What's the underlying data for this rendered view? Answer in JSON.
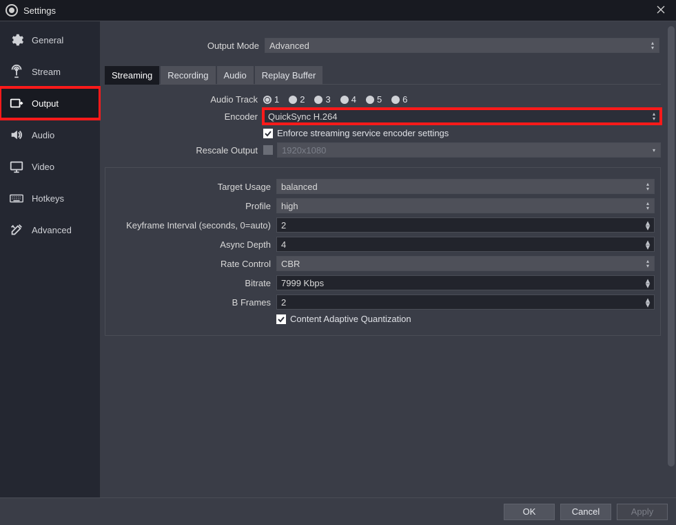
{
  "window": {
    "title": "Settings"
  },
  "sidebar": {
    "items": [
      {
        "label": "General"
      },
      {
        "label": "Stream"
      },
      {
        "label": "Output"
      },
      {
        "label": "Audio"
      },
      {
        "label": "Video"
      },
      {
        "label": "Hotkeys"
      },
      {
        "label": "Advanced"
      }
    ],
    "active_index": 2
  },
  "output_mode": {
    "label": "Output Mode",
    "value": "Advanced"
  },
  "tabs": [
    {
      "label": "Streaming"
    },
    {
      "label": "Recording"
    },
    {
      "label": "Audio"
    },
    {
      "label": "Replay Buffer"
    }
  ],
  "active_tab": 0,
  "streaming": {
    "audio_track_label": "Audio Track",
    "audio_tracks": [
      "1",
      "2",
      "3",
      "4",
      "5",
      "6"
    ],
    "audio_track_selected": 0,
    "encoder_label": "Encoder",
    "encoder_value": "QuickSync H.264",
    "enforce_label": "Enforce streaming service encoder settings",
    "enforce_checked": true,
    "rescale_label": "Rescale Output",
    "rescale_checked": false,
    "rescale_value": "1920x1080",
    "settings": {
      "target_usage": {
        "label": "Target Usage",
        "value": "balanced"
      },
      "profile": {
        "label": "Profile",
        "value": "high"
      },
      "keyframe": {
        "label": "Keyframe Interval (seconds, 0=auto)",
        "value": "2"
      },
      "async_depth": {
        "label": "Async Depth",
        "value": "4"
      },
      "rate_control": {
        "label": "Rate Control",
        "value": "CBR"
      },
      "bitrate": {
        "label": "Bitrate",
        "value": "7999 Kbps"
      },
      "bframes": {
        "label": "B Frames",
        "value": "2"
      },
      "caq_label": "Content Adaptive Quantization",
      "caq_checked": true
    }
  },
  "footer": {
    "ok": "OK",
    "cancel": "Cancel",
    "apply": "Apply"
  }
}
